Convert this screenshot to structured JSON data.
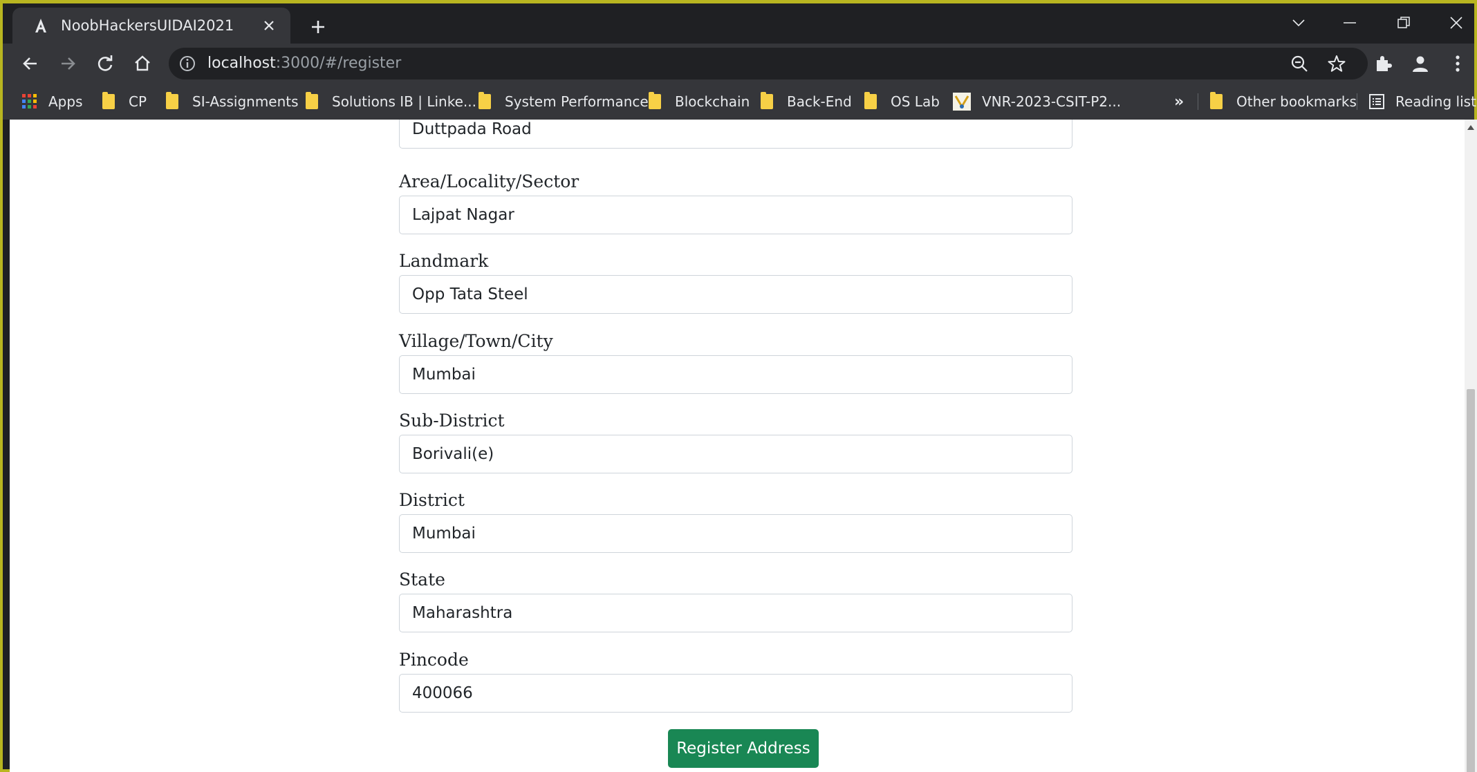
{
  "browser": {
    "tab_title": "NoobHackersUIDAI2021",
    "url_host": "localhost",
    "url_path": ":3000/#/register"
  },
  "bookmarks": {
    "apps_label": "Apps",
    "items": [
      {
        "label": "CP"
      },
      {
        "label": "SI-Assignments"
      },
      {
        "label": "Solutions IB | Linke..."
      },
      {
        "label": "System Performance"
      },
      {
        "label": "Blockchain"
      },
      {
        "label": "Back-End"
      },
      {
        "label": "OS Lab"
      },
      {
        "label": "VNR-2023-CSIT-P2..."
      }
    ],
    "overflow": "»",
    "other": "Other bookmarks",
    "reading_list": "Reading list"
  },
  "form": {
    "street_value": "Duttpada Road",
    "fields": [
      {
        "label": "Area/Locality/Sector",
        "value": "Lajpat Nagar"
      },
      {
        "label": "Landmark",
        "value": "Opp Tata Steel"
      },
      {
        "label": "Village/Town/City",
        "value": "Mumbai"
      },
      {
        "label": "Sub-District",
        "value": "Borivali(e)"
      },
      {
        "label": "District",
        "value": "Mumbai"
      },
      {
        "label": "State",
        "value": "Maharashtra"
      },
      {
        "label": "Pincode",
        "value": "400066"
      }
    ],
    "submit_label": "Register Address"
  }
}
